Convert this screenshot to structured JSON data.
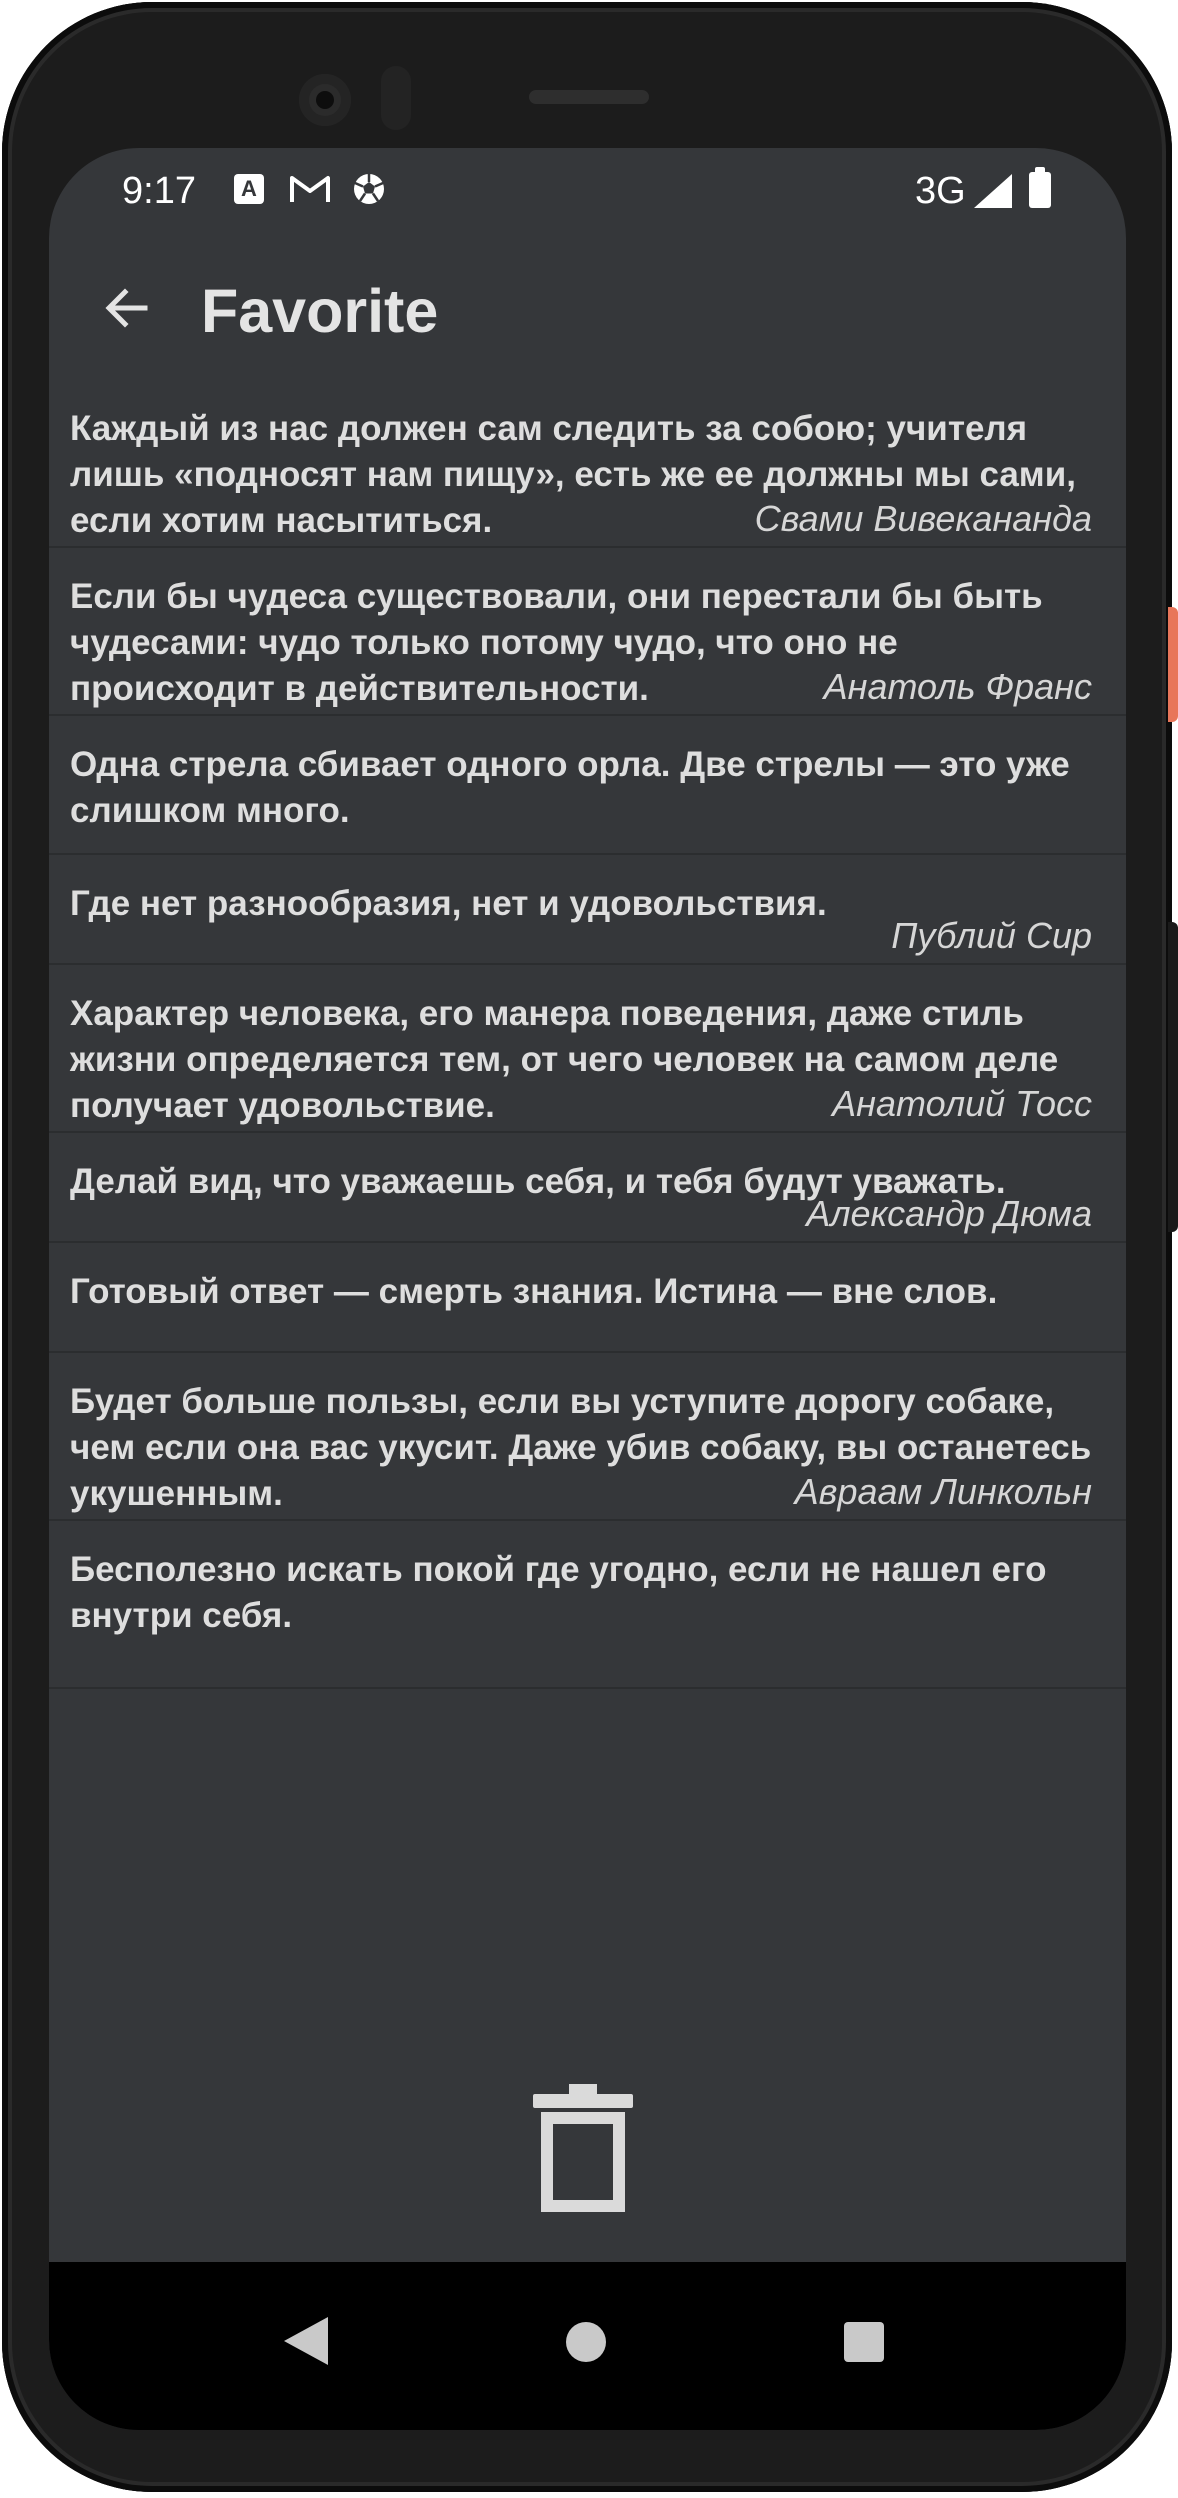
{
  "status_bar": {
    "time": "9:17",
    "network": "3G",
    "notification_icons": [
      "a-icon",
      "gmail-icon",
      "soccer-ball-icon"
    ],
    "system_icons": [
      "signal-icon",
      "battery-icon"
    ]
  },
  "toolbar": {
    "title": "Favorite",
    "back_icon": "arrow-left-icon"
  },
  "quotes": [
    {
      "text": "Каждый из нас должен сам следить за собою; учителя лишь «подносят нам пищу», есть же ее должны мы сами, если хотим насытиться.",
      "author": "Свами Вивекананда"
    },
    {
      "text": "Если бы чудеса существовали, они перестали бы быть чудесами: чудо только потому чудо, что оно не происходит в действительности.",
      "author": "Анатоль Франс"
    },
    {
      "text": "Одна стрела сбивает одного орла. Две стрелы — это уже слишком много.",
      "author": ""
    },
    {
      "text": "Где нет разнообразия, нет и удовольствия.",
      "author": "Публий Сир"
    },
    {
      "text": "Характер человека, его манера поведения, даже стиль жизни определяется тем, от чего человек на самом деле получает удовольствие.",
      "author": "Анатолий Тосс"
    },
    {
      "text": "Делай вид, что уважаешь себя, и тебя будут уважать.",
      "author": "Александр Дюма"
    },
    {
      "text": "Готовый ответ — смерть знания. Истина — вне слов.",
      "author": ""
    },
    {
      "text": "Будет больше пользы, если вы уступите дорогу собаке, чем если она вас укусит. Даже убив собаку, вы останетесь укушенным.",
      "author": "Авраам Линкольн"
    },
    {
      "text": "Бесполезно искать покой где угодно, если не нашел его внутри себя.",
      "author": ""
    }
  ],
  "fab": {
    "icon": "trash-icon"
  },
  "nav_bar": {
    "icons": [
      "nav-back-icon",
      "nav-home-icon",
      "nav-recents-icon"
    ]
  },
  "colors": {
    "background": "#35373a",
    "text": "#dedede",
    "divider": "#2b2d2f",
    "nav_bar": "#000000",
    "phone_frame": "#1c1c1c",
    "power_button_accent": "#e8765a"
  }
}
